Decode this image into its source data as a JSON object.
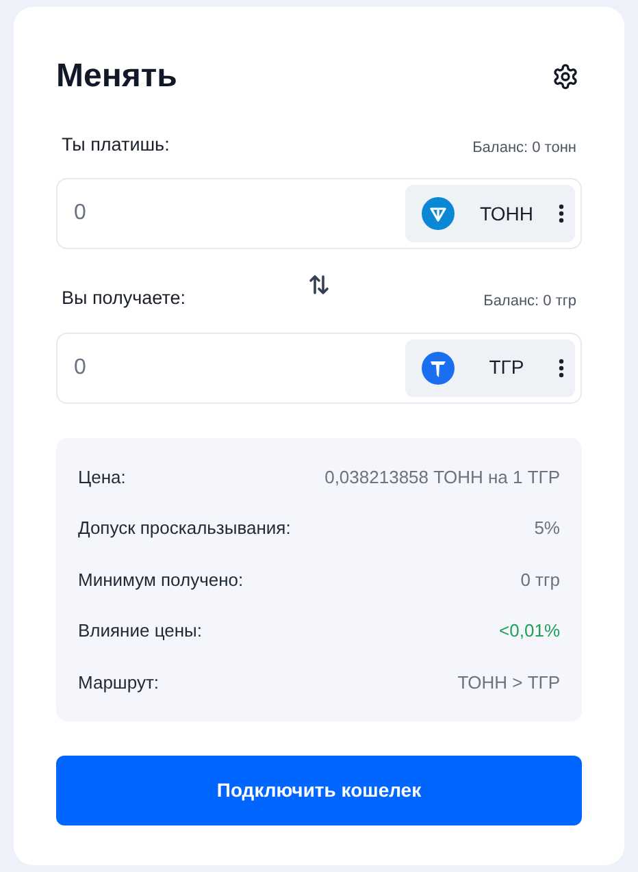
{
  "title": "Менять",
  "pay": {
    "label": "Ты платишь:",
    "balance": "Баланс: 0 тонн",
    "value": "0",
    "token": {
      "name": "ТОНН",
      "kind": "ton"
    }
  },
  "receive": {
    "label": "Вы получаете:",
    "balance": "Баланс: 0 тгр",
    "value": "0",
    "token": {
      "name": "ТГР",
      "kind": "tgr"
    }
  },
  "details": [
    {
      "label": "Цена:",
      "value": "0,038213858 ТОНН на 1 ТГР",
      "color": "#6b7280"
    },
    {
      "label": "Допуск проскальзывания:",
      "value": "5%",
      "color": "#6b7280"
    },
    {
      "label": "Минимум получено:",
      "value": "0 тгр",
      "color": "#6b7280"
    },
    {
      "label": "Влияние цены:",
      "value": "<0,01%",
      "color": "#22a05a"
    },
    {
      "label": "Маршрут:",
      "value": "ТОНН > ТГР",
      "color": "#6b7280"
    }
  ],
  "connect_button": "Подключить кошелек"
}
